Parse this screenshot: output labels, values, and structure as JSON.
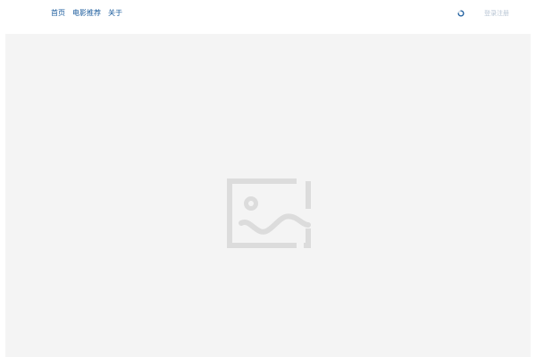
{
  "header": {
    "nav": [
      {
        "label": "首页"
      },
      {
        "label": "电影推荐"
      },
      {
        "label": "关于"
      }
    ],
    "loading_icon": "spinner-icon",
    "login_label": "登录注册"
  },
  "main": {
    "image_placeholder_icon": "image-placeholder-icon"
  },
  "colors": {
    "nav_text": "#1a5b9c",
    "login_text": "#b9c6d4",
    "content_bg": "#f4f4f4",
    "placeholder_icon": "#dcdcdc"
  }
}
